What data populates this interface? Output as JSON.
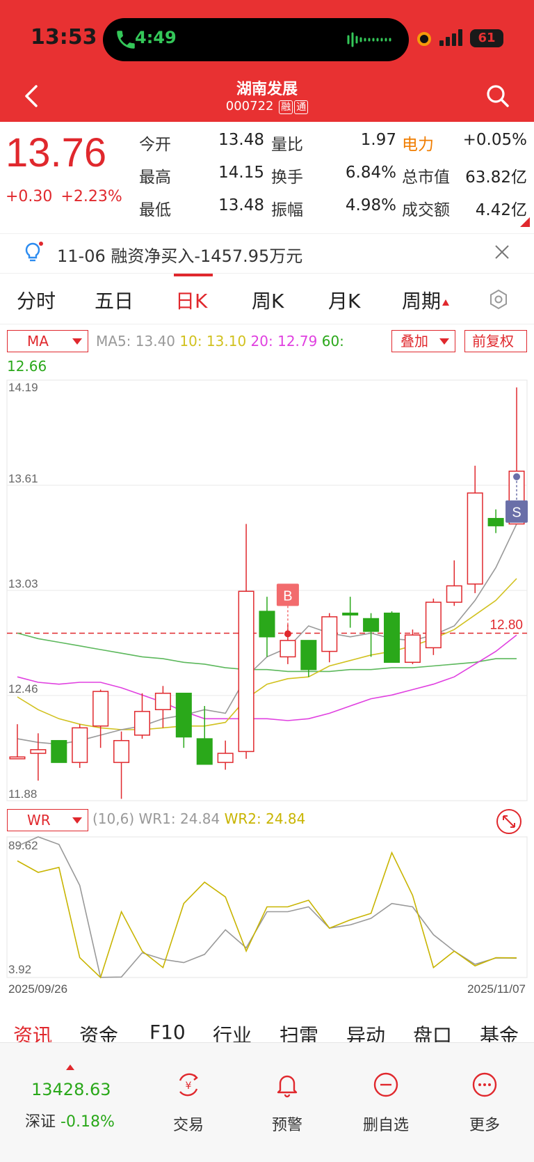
{
  "status_bar": {
    "time": "13:53",
    "call_time": "4:49",
    "battery": "61"
  },
  "header": {
    "stock_name": "湖南发展",
    "stock_code": "000722",
    "tags": [
      "融",
      "通"
    ]
  },
  "quote": {
    "price": "13.76",
    "change": "+0.30",
    "change_pct": "+2.23%",
    "rows": [
      [
        {
          "label": "今开",
          "value": "13.48"
        },
        {
          "label": "量比",
          "value": "1.97"
        },
        {
          "label": "电力",
          "value": "+0.05%"
        }
      ],
      [
        {
          "label": "最高",
          "value": "14.15"
        },
        {
          "label": "换手",
          "value": "6.84%"
        },
        {
          "label": "总市值",
          "value": "63.82亿"
        }
      ],
      [
        {
          "label": "最低",
          "value": "13.48"
        },
        {
          "label": "振幅",
          "value": "4.98%"
        },
        {
          "label": "成交额",
          "value": "4.42亿"
        }
      ]
    ]
  },
  "notice": {
    "text": "11-06 融资净买入-1457.95万元"
  },
  "tabs": [
    "分时",
    "五日",
    "日K",
    "周K",
    "月K",
    "周期"
  ],
  "active_tab": "日K",
  "indicator": {
    "ma_select": "MA",
    "ma5": "MA5: 13.40",
    "ma10": "10: 13.10",
    "ma20": "20: 12.79",
    "ma60": "60:",
    "ma60_value": "12.66",
    "overlay": "叠加",
    "adjust": "前复权"
  },
  "wr": {
    "select": "WR",
    "params": "(10,6)",
    "wr1": "WR1: 24.84",
    "wr2": "WR2: 24.84"
  },
  "colors": {
    "up": "#e0282d",
    "down": "#2aa81a",
    "ma5": "#999999",
    "ma10": "#d1c11e",
    "ma20": "#e040e0",
    "ma60": "#5cb85c"
  },
  "chart_data": {
    "type": "candlestick",
    "ylim": [
      11.88,
      14.19
    ],
    "y_ticks": [
      "14.19",
      "13.61",
      "13.03",
      "12.46",
      "11.88"
    ],
    "reference_line": {
      "value": 12.8,
      "label": "12.80"
    },
    "markers": [
      {
        "label": "B",
        "index": 13
      },
      {
        "label": "S",
        "index": 24
      }
    ],
    "x_range_labels": [
      "2025/09/26",
      "2025/11/07"
    ],
    "candles": [
      {
        "o": 12.11,
        "c": 12.12,
        "h": 12.3,
        "l": 12.11
      },
      {
        "o": 12.14,
        "c": 12.16,
        "h": 12.25,
        "l": 11.99
      },
      {
        "o": 12.21,
        "c": 12.09,
        "h": 12.21,
        "l": 12.09
      },
      {
        "o": 12.09,
        "c": 12.28,
        "h": 12.3,
        "l": 12.06
      },
      {
        "o": 12.29,
        "c": 12.48,
        "h": 12.49,
        "l": 12.17
      },
      {
        "o": 12.09,
        "c": 12.21,
        "h": 12.26,
        "l": 11.89
      },
      {
        "o": 12.24,
        "c": 12.37,
        "h": 12.47,
        "l": 12.22
      },
      {
        "o": 12.38,
        "c": 12.47,
        "h": 12.51,
        "l": 12.28
      },
      {
        "o": 12.47,
        "c": 12.23,
        "h": 12.47,
        "l": 12.17
      },
      {
        "o": 12.22,
        "c": 12.08,
        "h": 12.4,
        "l": 12.08
      },
      {
        "o": 12.09,
        "c": 12.14,
        "h": 12.21,
        "l": 12.05
      },
      {
        "o": 12.15,
        "c": 13.03,
        "h": 13.4,
        "l": 12.11
      },
      {
        "o": 12.92,
        "c": 12.78,
        "h": 13.0,
        "l": 12.67
      },
      {
        "o": 12.67,
        "c": 12.76,
        "h": 12.85,
        "l": 12.63
      },
      {
        "o": 12.76,
        "c": 12.6,
        "h": 12.76,
        "l": 12.56
      },
      {
        "o": 12.7,
        "c": 12.89,
        "h": 12.91,
        "l": 12.64
      },
      {
        "o": 12.91,
        "c": 12.9,
        "h": 13.0,
        "l": 12.83
      },
      {
        "o": 12.88,
        "c": 12.81,
        "h": 12.91,
        "l": 12.67
      },
      {
        "o": 12.91,
        "c": 12.64,
        "h": 12.92,
        "l": 12.64
      },
      {
        "o": 12.64,
        "c": 12.79,
        "h": 12.82,
        "l": 12.63
      },
      {
        "o": 12.72,
        "c": 12.97,
        "h": 12.99,
        "l": 12.68
      },
      {
        "o": 12.97,
        "c": 13.06,
        "h": 13.2,
        "l": 12.95
      },
      {
        "o": 13.07,
        "c": 13.57,
        "h": 13.72,
        "l": 13.02
      },
      {
        "o": 13.43,
        "c": 13.39,
        "h": 13.48,
        "l": 13.35
      },
      {
        "o": 13.4,
        "c": 13.69,
        "h": 14.15,
        "l": 13.4
      }
    ],
    "ma5": [
      12.22,
      12.2,
      12.19,
      12.21,
      12.24,
      12.27,
      12.29,
      12.33,
      12.35,
      12.38,
      12.36,
      12.56,
      12.67,
      12.72,
      12.84,
      12.8,
      12.78,
      12.8,
      12.77,
      12.76,
      12.79,
      12.84,
      12.98,
      13.16,
      13.4
    ],
    "ma10": [
      12.45,
      12.38,
      12.33,
      12.3,
      12.28,
      12.27,
      12.27,
      12.28,
      12.29,
      12.29,
      12.31,
      12.44,
      12.52,
      12.55,
      12.56,
      12.62,
      12.65,
      12.68,
      12.7,
      12.73,
      12.77,
      12.82,
      12.9,
      12.98,
      13.1
    ],
    "ma20": [
      12.56,
      12.53,
      12.52,
      12.53,
      12.53,
      12.5,
      12.46,
      12.42,
      12.37,
      12.33,
      12.33,
      12.33,
      12.33,
      12.32,
      12.33,
      12.36,
      12.4,
      12.44,
      12.46,
      12.49,
      12.52,
      12.56,
      12.63,
      12.7,
      12.79
    ],
    "ma60": [
      12.8,
      12.77,
      12.75,
      12.73,
      12.71,
      12.69,
      12.67,
      12.66,
      12.64,
      12.63,
      12.61,
      12.6,
      12.6,
      12.59,
      12.59,
      12.59,
      12.6,
      12.6,
      12.61,
      12.61,
      12.62,
      12.63,
      12.64,
      12.66,
      12.66
    ],
    "wr": {
      "ylim": [
        3.92,
        89.62
      ],
      "y_ticks": [
        "89.62",
        "3.92"
      ],
      "wr1": [
        84.0,
        89.6,
        85.0,
        60.0,
        4.0,
        4.2,
        19.0,
        15.0,
        13.0,
        18.0,
        33.0,
        22.0,
        44.0,
        44.0,
        47.0,
        34.0,
        36.0,
        40.0,
        49.0,
        47.0,
        30.0,
        20.0,
        12.0,
        15.8,
        15.7
      ],
      "wr2": [
        75.0,
        68.0,
        71.0,
        16.0,
        3.9,
        44.0,
        20.0,
        10.0,
        49.0,
        62.0,
        53.0,
        20.0,
        47.0,
        47.0,
        51.0,
        34.0,
        39.0,
        43.0,
        80.0,
        54.0,
        10.0,
        20.0,
        11.0,
        16.0,
        15.9
      ]
    }
  },
  "bottom_tabs": [
    "资讯",
    "资金",
    "F10",
    "行业",
    "扫雷",
    "异动",
    "盘口",
    "基金"
  ],
  "active_bottom_tab": "资讯",
  "footer": {
    "index_value": "13428.63",
    "index_name": "深证",
    "index_change": "-0.18%",
    "buttons": [
      "交易",
      "预警",
      "删自选",
      "更多"
    ]
  }
}
